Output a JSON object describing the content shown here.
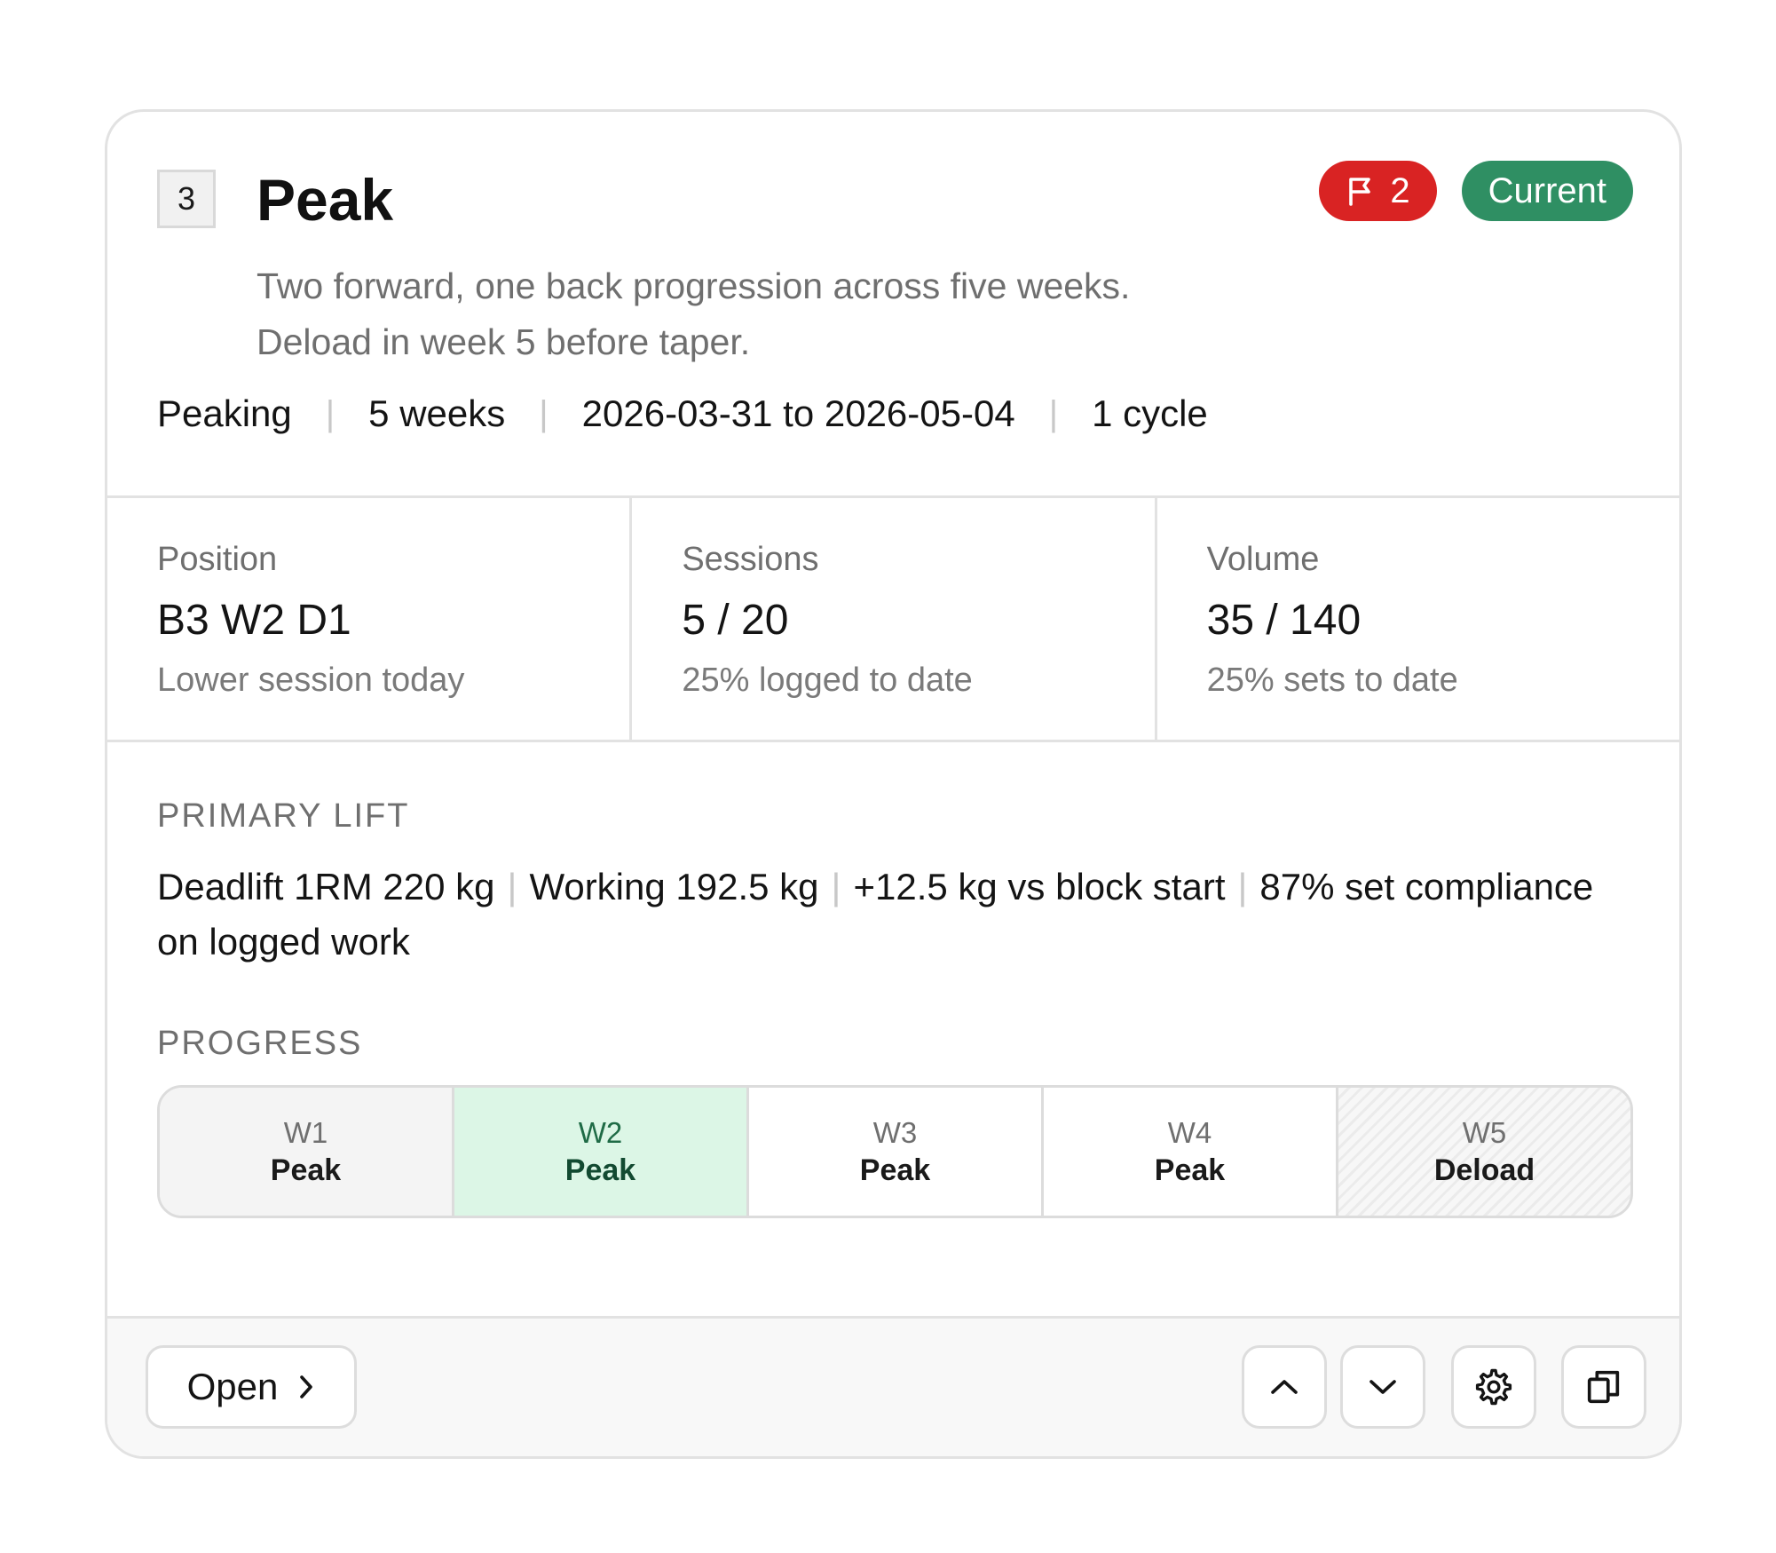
{
  "block": {
    "number": "3",
    "title": "Peak",
    "description_line1": "Two forward, one back progression across five weeks.",
    "description_line2": "Deload in week 5 before taper.",
    "badges": {
      "flag_count": "2",
      "status": "Current",
      "flag_color": "#d92323",
      "status_color": "#2f8f63"
    },
    "meta": {
      "phase": "Peaking",
      "duration": "5 weeks",
      "dates": "2026-03-31 to 2026-05-04",
      "cycles": "1 cycle"
    }
  },
  "stats": {
    "position": {
      "label": "Position",
      "value": "B3 W2 D1",
      "sub": "Lower session today"
    },
    "sessions": {
      "label": "Sessions",
      "value": "5 / 20",
      "sub": "25% logged to date"
    },
    "volume": {
      "label": "Volume",
      "value": "35 / 140",
      "sub": "25% sets to date"
    }
  },
  "primary_lift": {
    "heading": "PRIMARY LIFT",
    "one_rm": "Deadlift 1RM 220 kg",
    "working": "Working 192.5 kg",
    "delta": "+12.5 kg vs block start",
    "compliance": "87% set compliance on logged work"
  },
  "progress": {
    "heading": "PROGRESS",
    "weeks": [
      {
        "num": "W1",
        "name": "Peak",
        "state": "done"
      },
      {
        "num": "W2",
        "name": "Peak",
        "state": "current"
      },
      {
        "num": "W3",
        "name": "Peak",
        "state": "upcoming"
      },
      {
        "num": "W4",
        "name": "Peak",
        "state": "upcoming"
      },
      {
        "num": "W5",
        "name": "Deload",
        "state": "deload"
      }
    ]
  },
  "footer": {
    "open_label": "Open",
    "icons": [
      "chevron-up-icon",
      "chevron-down-icon",
      "gear-icon",
      "copy-icon"
    ]
  }
}
